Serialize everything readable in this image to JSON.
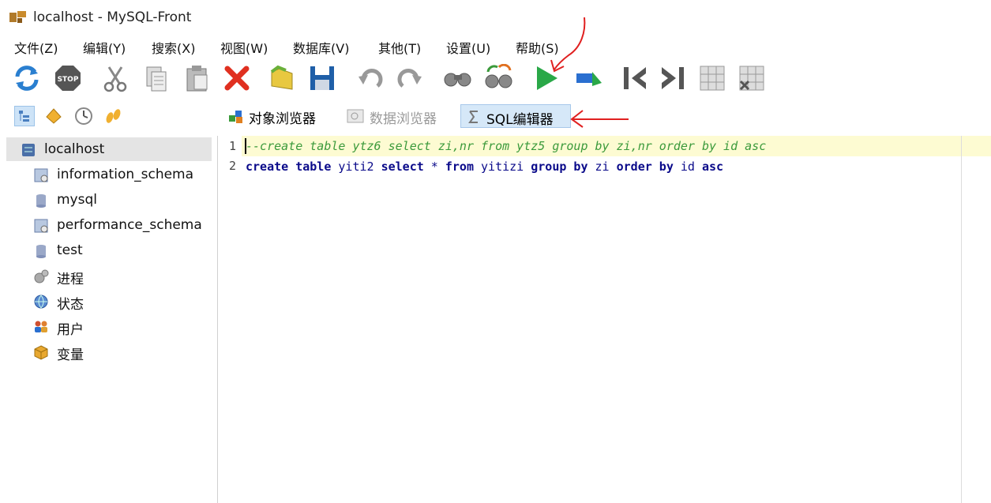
{
  "window": {
    "title": "localhost - MySQL-Front"
  },
  "menu": [
    "文件(Z)",
    "编辑(Y)",
    "搜索(X)",
    "视图(W)",
    "数据库(V)",
    "其他(T)",
    "设置(U)",
    "帮助(S)"
  ],
  "toolbar": {
    "icons": [
      "refresh-icon",
      "stop-icon",
      "cut-icon",
      "copy-icon",
      "paste-icon",
      "delete-icon",
      "open-icon",
      "save-icon",
      "undo-icon",
      "redo-icon",
      "find-icon",
      "replace-icon",
      "run-icon",
      "run-selection-icon",
      "first-icon",
      "last-icon",
      "insert-row-icon",
      "delete-row-icon"
    ],
    "stop_label": "STOP"
  },
  "tabs": {
    "object_browser": "对象浏览器",
    "data_browser": "数据浏览器",
    "sql_editor": "SQL编辑器"
  },
  "tree": {
    "root": "localhost",
    "items": [
      "information_schema",
      "mysql",
      "performance_schema",
      "test",
      "进程",
      "状态",
      "用户",
      "变量"
    ]
  },
  "editor": {
    "line_numbers": [
      "1",
      "2"
    ],
    "line1": "--create table ytz6 select zi,nr from ytz5 group by zi,nr order by id asc",
    "line2": {
      "k1": "create table",
      "t1": " yiti2 ",
      "k2": "select",
      "t2": " * ",
      "k3": "from",
      "t3": " yitizi ",
      "k4": "group by",
      "t4": " zi ",
      "k5": "order by",
      "t5": " id ",
      "k6": "asc"
    }
  },
  "colors": {
    "accent": "#cde3f7",
    "annotation": "#e02020",
    "comment": "#3b9a3b",
    "keyword": "#0a0a8a"
  }
}
